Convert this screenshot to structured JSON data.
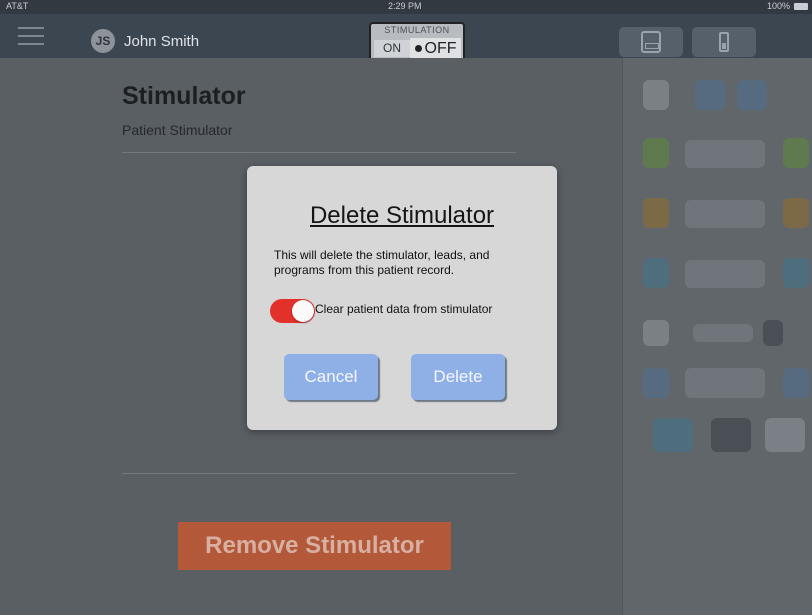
{
  "status_bar": {
    "carrier": "AT&T",
    "time": "2:29 PM",
    "battery": "100%"
  },
  "header": {
    "avatar_initials": "JS",
    "user_name": "John Smith",
    "stimulation_toggle": {
      "title": "STIMULATION",
      "on_label": "ON",
      "off_label": "OFF",
      "state": "OFF"
    },
    "icons": [
      "menu-icon",
      "remote-icon",
      "battery-icon"
    ]
  },
  "main": {
    "title": "Stimulator",
    "subtitle": "Patient Stimulator",
    "remove_button": "Remove Stimulator"
  },
  "dialog": {
    "title": "Delete Stimulator",
    "message": "This will delete the stimulator, leads, and programs from this patient record.",
    "switch_label": "Clear patient data from stimulator",
    "switch_on": true,
    "cancel_label": "Cancel",
    "delete_label": "Delete"
  },
  "colors": {
    "accent_blue": "#8fb0e6",
    "remove_red": "#b4583a",
    "switch_red": "#e2302a"
  }
}
